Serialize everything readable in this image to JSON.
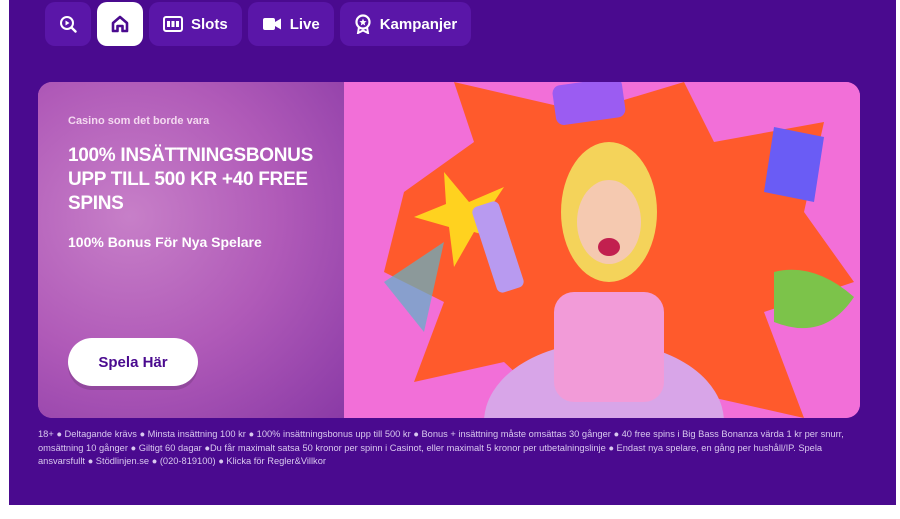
{
  "nav": {
    "items": [
      {
        "label": "",
        "icon": "search-play-icon"
      },
      {
        "label": "",
        "icon": "home-icon",
        "active": true
      },
      {
        "label": "Slots",
        "icon": "slot-machine-icon"
      },
      {
        "label": "Live",
        "icon": "video-camera-icon"
      },
      {
        "label": "Kampanjer",
        "icon": "badge-icon"
      }
    ]
  },
  "banner": {
    "tagline": "Casino som det borde vara",
    "headline": "100% INSÄTTNINGSBONUS UPP TILL 500 KR +40 FREE SPINS",
    "subline": "100% Bonus För Nya Spelare",
    "cta_label": "Spela Här",
    "image": "promotional-character-artwork"
  },
  "disclaimer": "18+ ● Deltagande krävs ● Minsta insättning 100 kr ● 100% insättningsbonus upp till 500 kr ● Bonus + insättning måste omsättas 30 gånger ● 40 free spins i Big Bass Bonanza värda 1 kr per snurr, omsättning 10 gånger ● Giltigt 60 dagar ●Du får maximalt satsa 50 kronor per spinn i Casinot, eller maximalt 5 kronor per utbetalningslinje ● Endast nya spelare, en gång per hushåll/IP. Spela ansvarsfullt ● Stödlinjen.se ● (020-819100) ● Klicka för Regler&Villkor",
  "colors": {
    "background": "#4a0a8f",
    "nav_button": "#5a16a8",
    "accent_pink": "#f26fd8",
    "burst_orange": "#ff5a2c"
  }
}
